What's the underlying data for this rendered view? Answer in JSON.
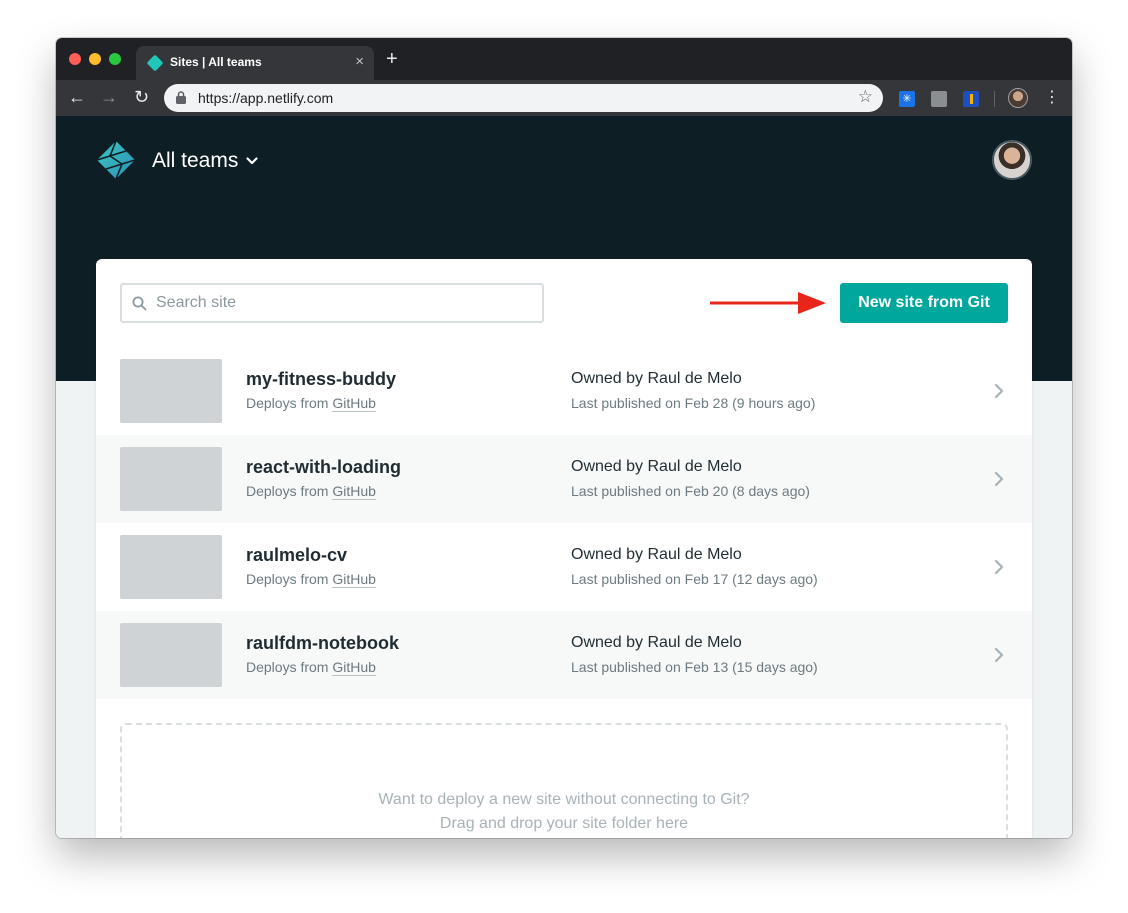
{
  "browser": {
    "tab_title": "Sites | All teams",
    "tab_close": "×",
    "new_tab": "+",
    "url": "https://app.netlify.com",
    "back": "←",
    "forward": "→",
    "reload": "↻",
    "star": "☆",
    "menu": "⋮"
  },
  "header": {
    "team_name": "All teams"
  },
  "toolbar": {
    "search_placeholder": "Search site",
    "search_value": "",
    "new_site_label": "New site from Git"
  },
  "sites": [
    {
      "name": "my-fitness-buddy",
      "deploy_prefix": "Deploys from ",
      "deploy_source": "GitHub",
      "owner_label": "Owned by ",
      "owner": "Raul de Melo",
      "published": "Last published on Feb 28 (9 hours ago)"
    },
    {
      "name": "react-with-loading",
      "deploy_prefix": "Deploys from ",
      "deploy_source": "GitHub",
      "owner_label": "Owned by ",
      "owner": "Raul de Melo",
      "published": "Last published on Feb 20 (8 days ago)"
    },
    {
      "name": "raulmelo-cv",
      "deploy_prefix": "Deploys from ",
      "deploy_source": "GitHub",
      "owner_label": "Owned by ",
      "owner": "Raul de Melo",
      "published": "Last published on Feb 17 (12 days ago)"
    },
    {
      "name": "raulfdm-notebook",
      "deploy_prefix": "Deploys from ",
      "deploy_source": "GitHub",
      "owner_label": "Owned by ",
      "owner": "Raul de Melo",
      "published": "Last published on Feb 13 (15 days ago)"
    }
  ],
  "dropzone": {
    "line1": "Want to deploy a new site without connecting to Git?",
    "line2": "Drag and drop your site folder here"
  },
  "colors": {
    "primary": "#00a79d",
    "header_bg": "#0e1e25",
    "annotation_arrow": "#e8251a"
  }
}
